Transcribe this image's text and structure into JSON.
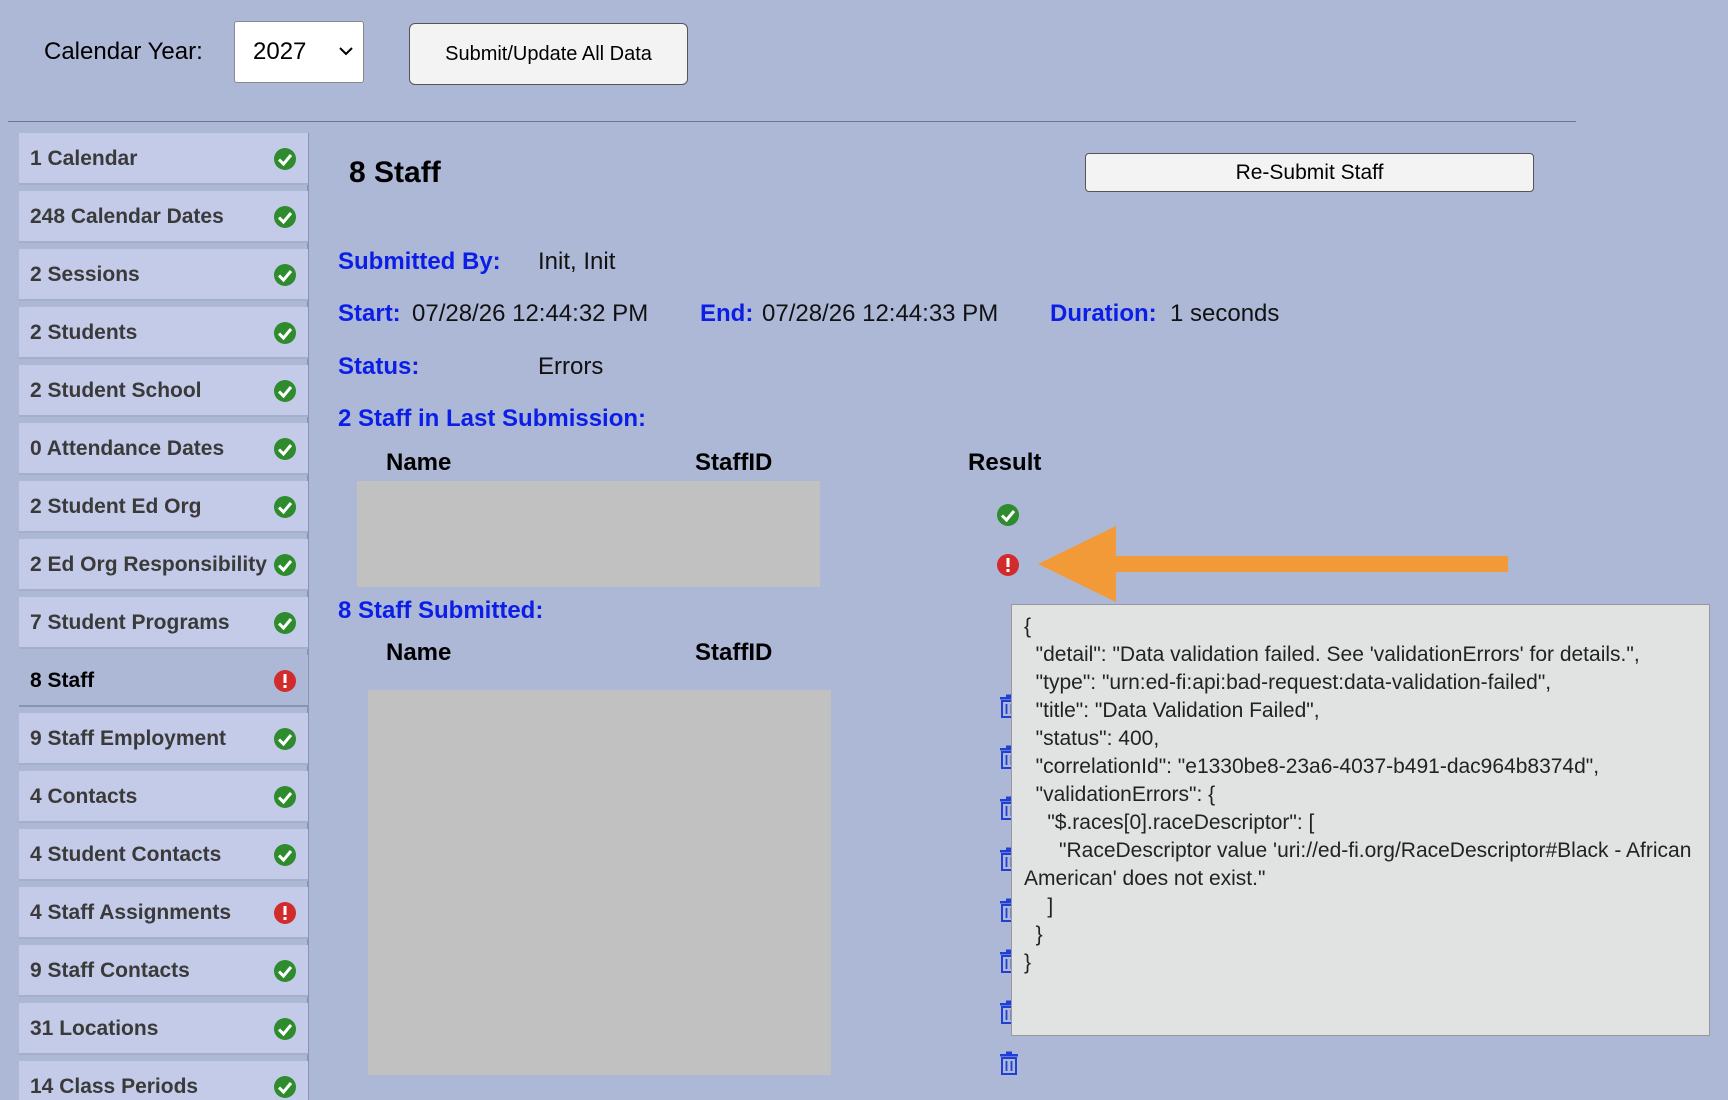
{
  "header": {
    "calendar_year_label": "Calendar Year:",
    "calendar_year_value": "2027",
    "submit_all_label": "Submit/Update All Data"
  },
  "sidebar": {
    "items": [
      {
        "label": "1 Calendar",
        "status": "ok"
      },
      {
        "label": "248 Calendar Dates",
        "status": "ok"
      },
      {
        "label": "2 Sessions",
        "status": "ok"
      },
      {
        "label": "2 Students",
        "status": "ok"
      },
      {
        "label": "2 Student School",
        "status": "ok"
      },
      {
        "label": "0 Attendance Dates",
        "status": "ok"
      },
      {
        "label": "2 Student Ed Org",
        "status": "ok"
      },
      {
        "label": "2 Ed Org Responsibility",
        "status": "ok"
      },
      {
        "label": "7 Student Programs",
        "status": "ok"
      },
      {
        "label": "8 Staff",
        "status": "error",
        "active": true
      },
      {
        "label": "9 Staff Employment",
        "status": "ok"
      },
      {
        "label": "4 Contacts",
        "status": "ok"
      },
      {
        "label": "4 Student Contacts",
        "status": "ok"
      },
      {
        "label": "4 Staff Assignments",
        "status": "error"
      },
      {
        "label": "9 Staff Contacts",
        "status": "ok"
      },
      {
        "label": "31 Locations",
        "status": "ok"
      },
      {
        "label": "14 Class Periods",
        "status": "ok"
      }
    ]
  },
  "main": {
    "title": "8 Staff",
    "resubmit_label": "Re-Submit Staff",
    "submitted_by_label": "Submitted By:",
    "submitted_by_value": "Init, Init",
    "start_label": "Start:",
    "start_value": "07/28/26 12:44:32 PM",
    "end_label": "End:",
    "end_value": "07/28/26 12:44:33 PM",
    "duration_label": "Duration:",
    "duration_value": "1 seconds",
    "status_label": "Status:",
    "status_value": "Errors",
    "last_submission_heading": "2 Staff in Last Submission:",
    "submitted_heading": "8 Staff Submitted:",
    "col_name": "Name",
    "col_staffid": "StaffID",
    "col_result": "Result"
  },
  "tooltip": {
    "text": "{\n  \"detail\": \"Data validation failed. See 'validationErrors' for details.\",\n  \"type\": \"urn:ed-fi:api:bad-request:data-validation-failed\",\n  \"title\": \"Data Validation Failed\",\n  \"status\": 400,\n  \"correlationId\": \"e1330be8-23a6-4037-b491-dac964b8374d\",\n  \"validationErrors\": {\n    \"$.races[0].raceDescriptor\": [\n      \"RaceDescriptor value 'uri://ed-fi.org/RaceDescriptor#Black - African American' does not exist.\"\n    ]\n  }\n}"
  },
  "colors": {
    "ok": "#2e8b2e",
    "error": "#d22b2b",
    "label_blue": "#0b1ee8",
    "arrow": "#f29a38",
    "trash": "#1f3fd8"
  }
}
